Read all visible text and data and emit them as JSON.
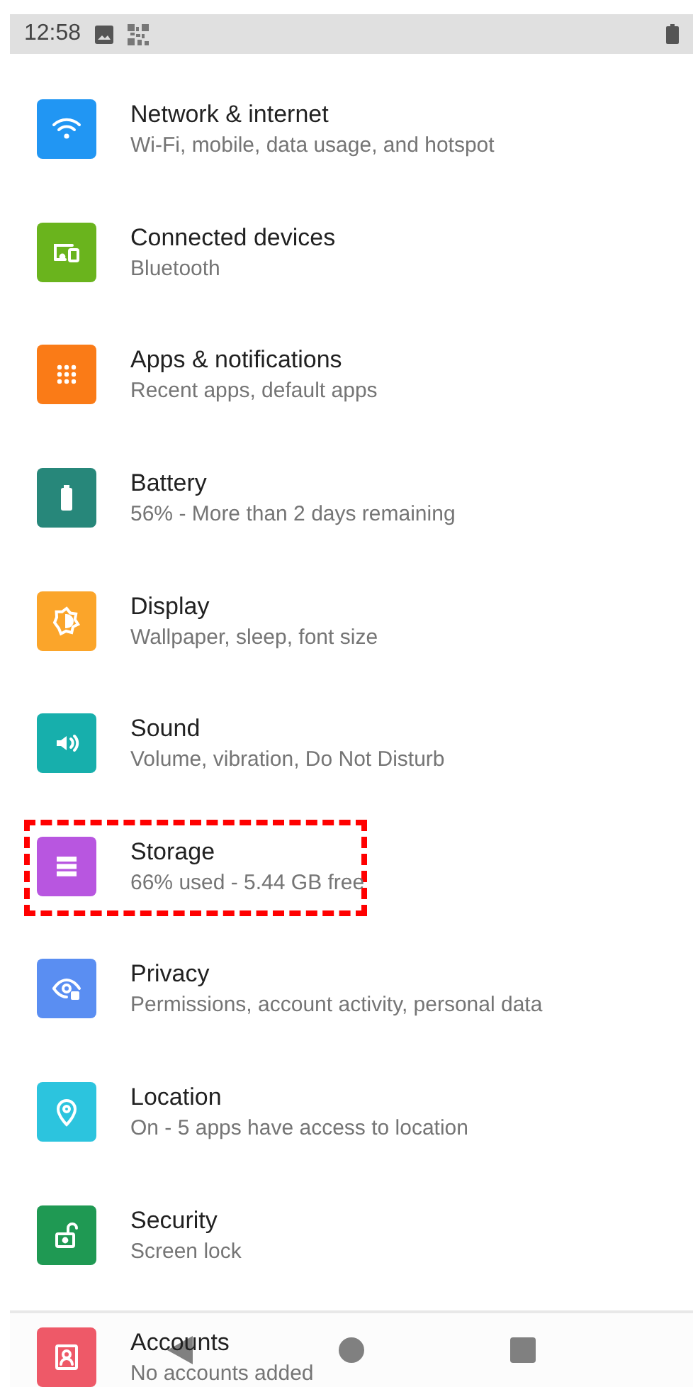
{
  "status_bar": {
    "time": "12:58"
  },
  "settings": [
    {
      "kind": "wifi",
      "color": "#2196f3",
      "title": "Network & internet",
      "subtitle": "Wi-Fi, mobile, data usage, and hotspot",
      "highlighted": false
    },
    {
      "kind": "devices",
      "color": "#6ab41d",
      "title": "Connected devices",
      "subtitle": "Bluetooth",
      "highlighted": false
    },
    {
      "kind": "apps",
      "color": "#fa7b17",
      "title": "Apps & notifications",
      "subtitle": "Recent apps, default apps",
      "highlighted": false
    },
    {
      "kind": "battery",
      "color": "#27877a",
      "title": "Battery",
      "subtitle": "56% - More than 2 days remaining",
      "highlighted": false
    },
    {
      "kind": "display",
      "color": "#fba52a",
      "title": "Display",
      "subtitle": "Wallpaper, sleep, font size",
      "highlighted": false
    },
    {
      "kind": "sound",
      "color": "#17afac",
      "title": "Sound",
      "subtitle": "Volume, vibration, Do Not Disturb",
      "highlighted": false
    },
    {
      "kind": "storage",
      "color": "#b856e0",
      "title": "Storage",
      "subtitle": "66% used - 5.44 GB free",
      "highlighted": true
    },
    {
      "kind": "privacy",
      "color": "#5a8ef2",
      "title": "Privacy",
      "subtitle": "Permissions, account activity, personal data",
      "highlighted": false
    },
    {
      "kind": "location",
      "color": "#2cc4de",
      "title": "Location",
      "subtitle": "On - 5 apps have access to location",
      "highlighted": false
    },
    {
      "kind": "security",
      "color": "#1f9953",
      "title": "Security",
      "subtitle": "Screen lock",
      "highlighted": false
    },
    {
      "kind": "accounts",
      "color": "#ee5968",
      "title": "Accounts",
      "subtitle": "No accounts added",
      "highlighted": false
    }
  ]
}
